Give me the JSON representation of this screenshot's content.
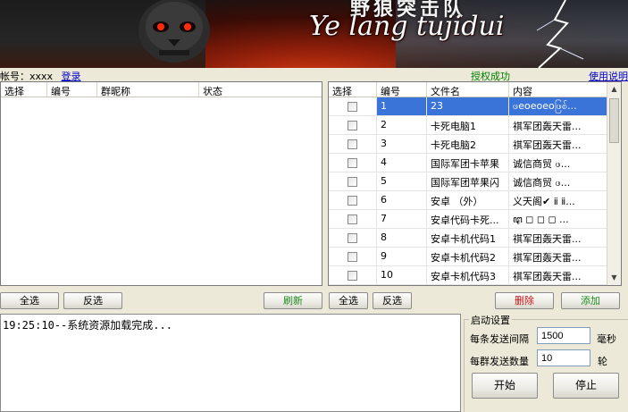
{
  "banner": {
    "title_cn": "野狼突击队",
    "title_en": "Ye lang tujidui"
  },
  "account": {
    "label": "帐号：",
    "value": "xxxx",
    "login_link": "登录"
  },
  "auth_status": "授权成功",
  "help_link": "使用说明",
  "group_table": {
    "columns": [
      "选择",
      "编号",
      "群昵称",
      "状态"
    ],
    "rows": []
  },
  "file_table": {
    "columns": [
      "选择",
      "编号",
      "文件名",
      "内容"
    ],
    "rows": [
      {
        "id": "1",
        "name": "23",
        "content": "ဖeoeoeoဖြစ်...",
        "selected": true
      },
      {
        "id": "2",
        "name": "卡死电脑1",
        "content": "祺军团轰天雷..."
      },
      {
        "id": "3",
        "name": "卡死电脑2",
        "content": "祺军团轰天雷..."
      },
      {
        "id": "4",
        "name": "国际军团卡苹果",
        "content": "诚信商贸 ဖ..."
      },
      {
        "id": "5",
        "name": "国际军团苹果闪",
        "content": "诚信商贸 ဖ..."
      },
      {
        "id": "6",
        "name": "安卓 （外）",
        "content": "义天阁✔ ⅱ ⅱ..."
      },
      {
        "id": "7",
        "name": "安卓代码卡死...",
        "content": "ꦛ ◻ ◻ ◻ ..."
      },
      {
        "id": "8",
        "name": "安卓卡机代码1",
        "content": "祺军团轰天雷..."
      },
      {
        "id": "9",
        "name": "安卓卡机代码2",
        "content": "祺军团轰天雷..."
      },
      {
        "id": "10",
        "name": "安卓卡机代码3",
        "content": "祺军团轰天雷..."
      }
    ]
  },
  "buttons": {
    "select_all_left": "全选",
    "invert_left": "反选",
    "refresh": "刷新",
    "select_all_right": "全选",
    "invert_right": "反选",
    "delete": "删除",
    "add": "添加",
    "start": "开始",
    "stop": "停止"
  },
  "log_text": "19:25:10--系统资源加载完成...",
  "settings": {
    "title": "启动设置",
    "interval_label": "每条发送间隔",
    "interval_value": "1500",
    "interval_unit": "毫秒",
    "count_label": "每群发送数量",
    "count_value": "10",
    "count_unit": "轮"
  },
  "colors": {
    "selection": "#3b74d8",
    "green_text": "#1d8a1d",
    "red_text": "#c81414",
    "link": "#0000cc"
  }
}
